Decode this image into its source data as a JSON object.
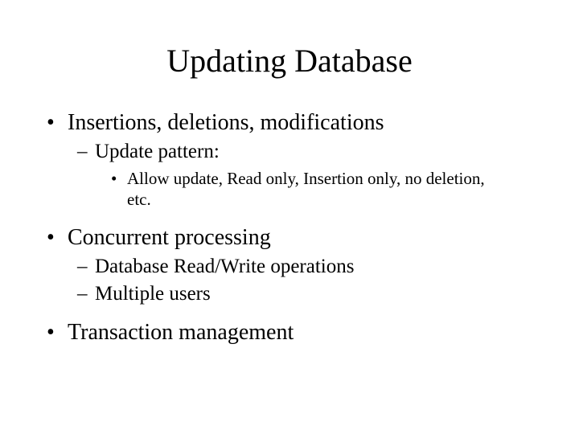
{
  "title": "Updating Database",
  "bullets": {
    "b1": "Insertions, deletions, modifications",
    "b1_1": "Update pattern:",
    "b1_1_1": "Allow update, Read only, Insertion only,  no deletion, etc.",
    "b2": "Concurrent processing",
    "b2_1": "Database Read/Write operations",
    "b2_2": "Multiple users",
    "b3": "Transaction management"
  }
}
